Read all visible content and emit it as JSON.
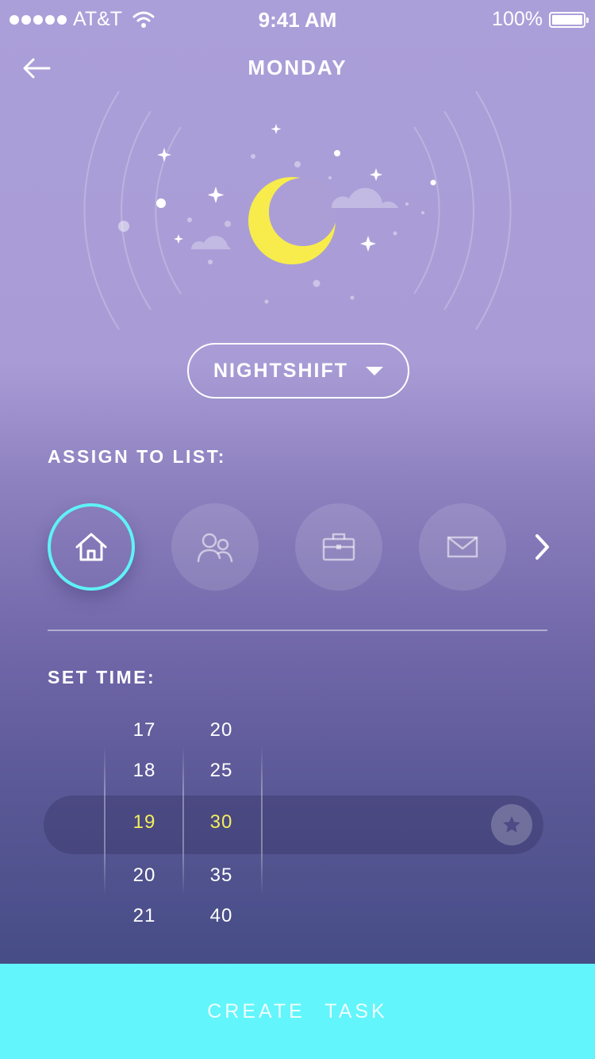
{
  "status_bar": {
    "carrier": "AT&T",
    "time": "9:41 AM",
    "battery": "100%"
  },
  "header": {
    "title": "MONDAY",
    "back_icon": "arrow-left-icon"
  },
  "illustration": {
    "moon_color": "#f7ec4c",
    "icons": [
      "moon-icon",
      "cloud-icon",
      "sparkle-icon"
    ]
  },
  "shift_dropdown": {
    "value": "NIGHTSHIFT"
  },
  "assign": {
    "label": "ASSIGN TO LIST:",
    "lists": [
      {
        "icon": "home-icon",
        "selected": true
      },
      {
        "icon": "people-icon",
        "selected": false
      },
      {
        "icon": "briefcase-icon",
        "selected": false
      },
      {
        "icon": "mail-icon",
        "selected": false
      }
    ],
    "next_icon": "chevron-right-icon"
  },
  "set_time": {
    "label": "SET TIME:",
    "hours": [
      "17",
      "18",
      "19",
      "20",
      "21"
    ],
    "minutes": [
      "20",
      "25",
      "30",
      "35",
      "40"
    ],
    "selected_hour": "19",
    "selected_minute": "30",
    "star_icon": "star-icon"
  },
  "create_button": {
    "label": "CREATE TASK"
  },
  "colors": {
    "accent": "#62f5fb",
    "selected_time": "#f3ee5e",
    "active_ring": "#5ff2f6"
  }
}
